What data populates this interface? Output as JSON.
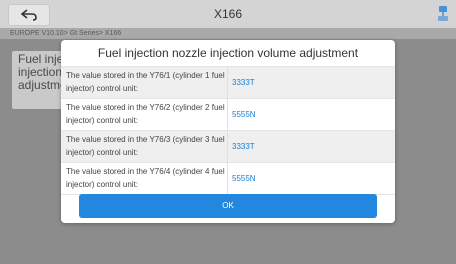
{
  "header": {
    "title": "X166"
  },
  "breadcrumb": "EUROPE V10.10> Gt Series> X166",
  "background_card": {
    "text": "Fuel injection nozzle injection volume adjustment"
  },
  "dialog": {
    "title": "Fuel injection nozzle injection volume adjustment",
    "rows": [
      {
        "label": "The value stored in the Y76/1 (cylinder 1 fuel injector) control unit:",
        "value": "3333T"
      },
      {
        "label": "The value stored in the Y76/2 (cylinder 2 fuel injector) control unit:",
        "value": "5555N"
      },
      {
        "label": "The value stored in the Y76/3 (cylinder 3 fuel injector) control unit:",
        "value": "3333T"
      },
      {
        "label": "The value stored in the Y76/4 (cylinder 4 fuel injector) control unit:",
        "value": "5555N"
      }
    ],
    "ok_label": "OK"
  },
  "icons": {
    "back": "back-arrow-icon",
    "corner": "vci-connection-icon"
  },
  "colors": {
    "accent": "#2387df",
    "value_text": "#1e7fd0"
  }
}
